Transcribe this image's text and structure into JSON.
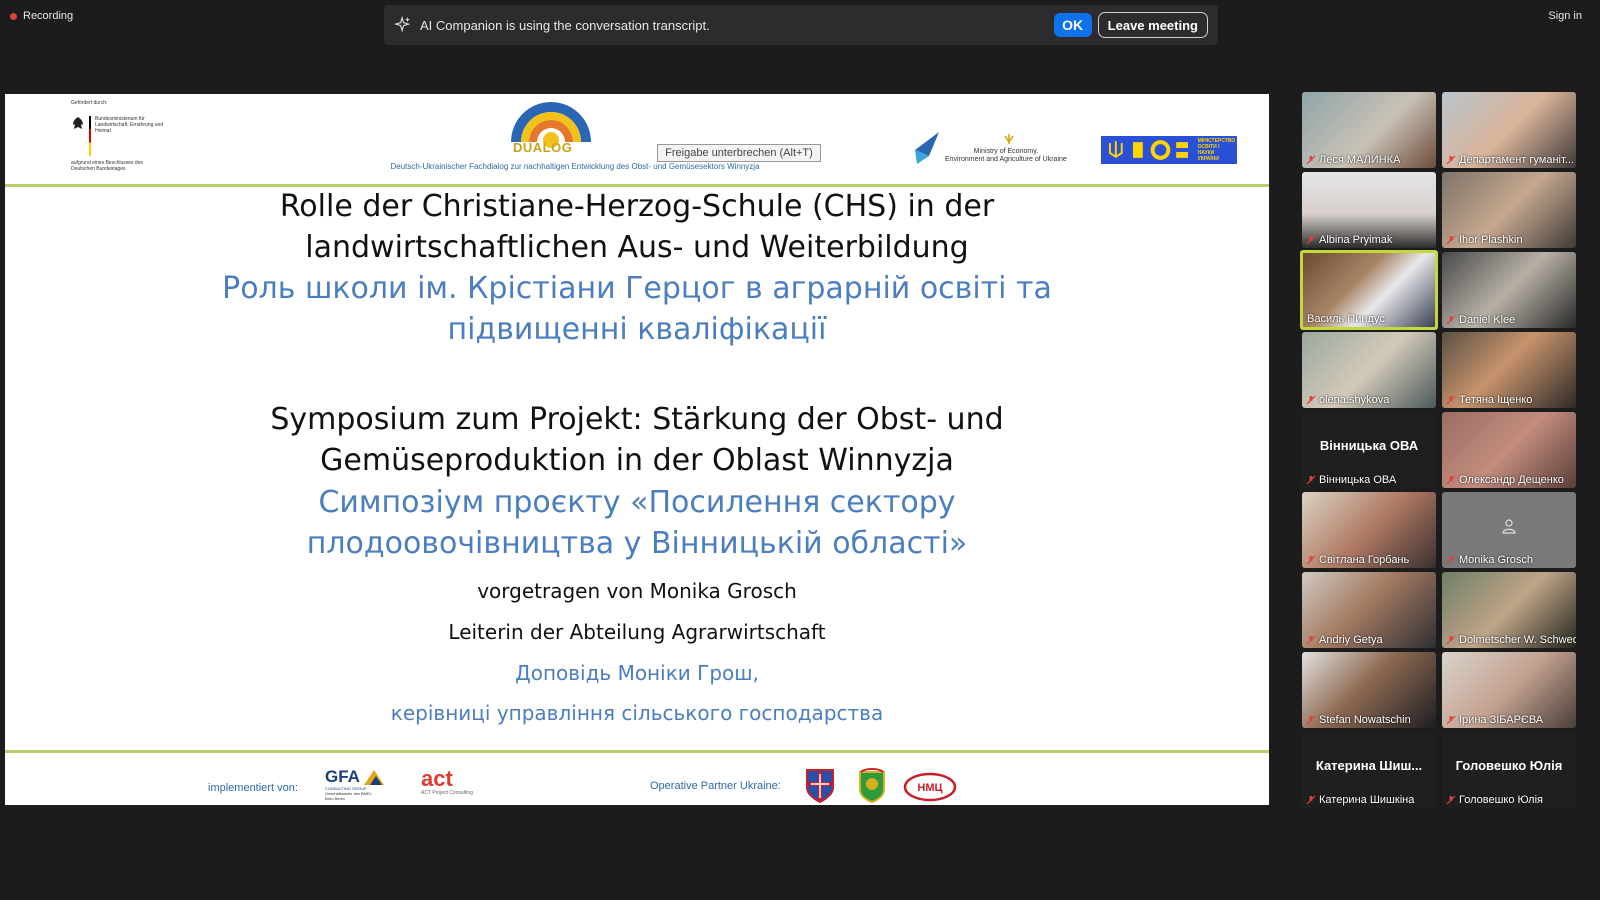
{
  "top": {
    "recording_label": "Recording",
    "ai_banner_text": "AI Companion is using the conversation transcript.",
    "ok_label": "OK",
    "leave_label": "Leave meeting",
    "signin_label": "Sign in"
  },
  "slide": {
    "tooltip": "Freigabe unterbrechen (Alt+T)",
    "german_logo_top": "Gefördert durch:",
    "german_logo_mid": "Bundesministerium für Landwirtschaft, Ernährung und Heimat",
    "german_logo_bottom": "aufgrund eines Beschlusses des Deutschen Bundestages",
    "dualog_label": "DUALOG",
    "dualog_arc": "Deutsch-Ukrainischer Fachdialog",
    "dualog_sub": "Deutsch-Ukrainischer Fachdialog zur nachhaltigen Entwicklung des Obst- und Gemüsesektors Winnyzja",
    "mineco_text_1": "Ministry of Economy,",
    "mineco_text_2": "Environment and Agriculture of Ukraine",
    "mon_text_1": "МІНІСТЕРСТВО",
    "mon_text_2": "ОСВІТИ І НАУКИ",
    "mon_text_3": "УКРАЇНИ",
    "title_de_1": "Rolle der Christiane-Herzog-Schule (CHS) in der",
    "title_de_2": "landwirtschaftlichen Aus- und Weiterbildung",
    "title_ua_1": "Роль школи ім. Крістіани Герцог в аграрній освіті та",
    "title_ua_2": "підвищенні кваліфікації",
    "sym_de_1": "Symposium zum Projekt: Stärkung der Obst- und",
    "sym_de_2": "Gemüseproduktion in der Oblast Winnyzja",
    "sym_ua_1": "Симпозіум проєкту «Посилення сектору",
    "sym_ua_2": "плодоовочівництва у Вінницькій області»",
    "presented_de": "vorgetragen von Monika Grosch",
    "role_de": "Leiterin der Abteilung Agrarwirtschaft",
    "presented_ua": "Доповідь Моніки Грош,",
    "role_ua": "керівниці управління сільського господарства",
    "implemented_label": "implementiert von:",
    "gfa_text": "GFA",
    "gfa_sub": "CONSULTING GROUP",
    "gfa_sub2": "Geschäftsstelle des BMEL",
    "gfa_sub3": "Büro Berlin",
    "act_text": "act",
    "act_sub": "ACT Project Consulting",
    "partner_label": "Operative Partner Ukraine:",
    "nmc_text": "НМЦ"
  },
  "participants": [
    {
      "name": "Леся МАЛИНКА",
      "tile": "video"
    },
    {
      "name": "Департамент гуманіт...",
      "tile": "video"
    },
    {
      "name": "Albina Pryimak",
      "tile": "video"
    },
    {
      "name": "Ihor Plashkin",
      "tile": "video"
    },
    {
      "name": "Василь Пиндус",
      "tile": "video",
      "active": true
    },
    {
      "name": "Daniel Klee",
      "tile": "video"
    },
    {
      "name": "olena.shykova",
      "tile": "video"
    },
    {
      "name": "Тетяна Іщенко",
      "tile": "video"
    },
    {
      "name": "Вінницька ОВА",
      "tile": "name",
      "big": "Вінницька ОВА"
    },
    {
      "name": "Олександр Дещенко",
      "tile": "video"
    },
    {
      "name": "Світлана Горбань",
      "tile": "video"
    },
    {
      "name": "Monika Grosch",
      "tile": "video"
    },
    {
      "name": "Andriy Getya",
      "tile": "video"
    },
    {
      "name": "Dolmetscher W. Schwed",
      "tile": "video"
    },
    {
      "name": "Stefan Nowatschin",
      "tile": "video"
    },
    {
      "name": "Ірина ЗІБАРЄВА",
      "tile": "video"
    },
    {
      "name": "Катерина Шишкіна",
      "tile": "name",
      "big": "Катерина  Шиш..."
    },
    {
      "name": "Головешко Юлія",
      "tile": "name",
      "big": "Головешко Юлія"
    }
  ],
  "colors": {
    "zoom_blue": "#0e72ed",
    "active_speaker": "#c4d73b",
    "slide_accent_line": "#b7cf6a",
    "ukrainian_text": "#4b7ec1",
    "mute_icon": "#e0413c"
  }
}
